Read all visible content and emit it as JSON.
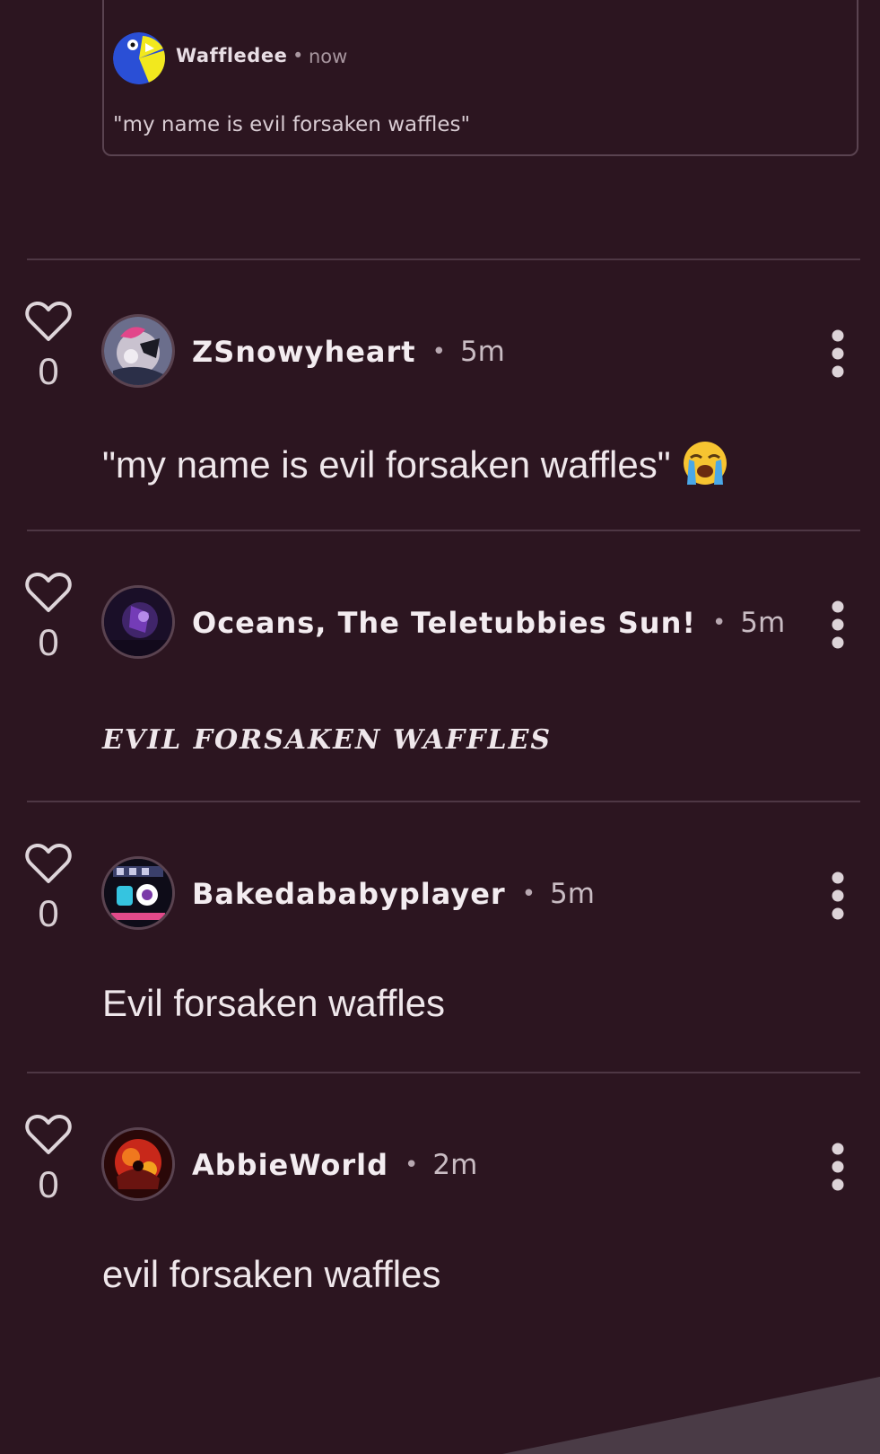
{
  "quoted": {
    "username": "Waffledee",
    "separator": "•",
    "time": "now",
    "text": "\"my name is evil forsaken waffles\""
  },
  "comments": [
    {
      "likes": "0",
      "username": "ZSnowyheart",
      "separator": "•",
      "time": "5m",
      "text": "\"my name is evil forsaken waffles\""
    },
    {
      "likes": "0",
      "username": "Oceans, The Teletubbies Sun!",
      "separator": "•",
      "time": "5m",
      "text": "EVIL FORSAKEN WAFFLES"
    },
    {
      "likes": "0",
      "username": "Bakedababyplayer",
      "separator": "•",
      "time": "5m",
      "text": "Evil forsaken waffles"
    },
    {
      "likes": "0",
      "username": "AbbieWorld",
      "separator": "•",
      "time": "2m",
      "text": "evil forsaken waffles"
    }
  ],
  "icons": {
    "like": "heart-outline-icon",
    "more": "more-vertical-icon",
    "emoji": "loudly-crying-face-emoji"
  },
  "colors": {
    "background": "#2c1520",
    "divider": "#4e3744",
    "text": "#efe7eb",
    "muted": "#c9bcc3"
  }
}
